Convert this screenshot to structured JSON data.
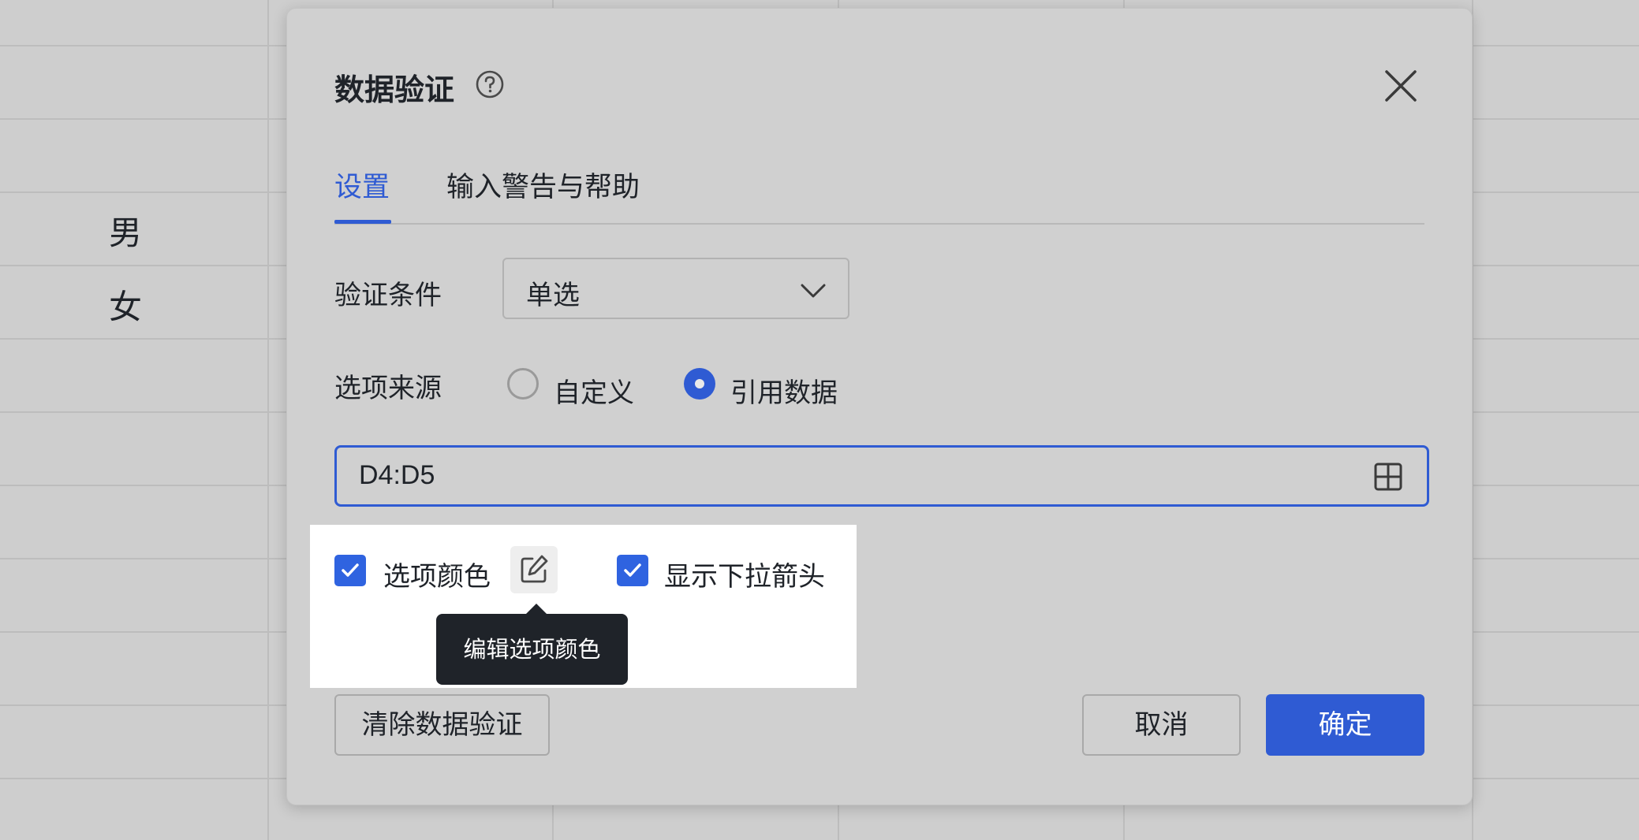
{
  "sheet": {
    "cells": [
      "男",
      "女"
    ]
  },
  "dialog": {
    "title": "数据验证",
    "tabs": [
      {
        "label": "设置",
        "active": true
      },
      {
        "label": "输入警告与帮助",
        "active": false
      }
    ],
    "condition": {
      "label": "验证条件",
      "value": "单选"
    },
    "source": {
      "label": "选项来源",
      "options": [
        {
          "label": "自定义",
          "selected": false
        },
        {
          "label": "引用数据",
          "selected": true
        }
      ]
    },
    "range": {
      "value": "D4:D5"
    },
    "options": {
      "color": {
        "label": "选项颜色",
        "checked": true
      },
      "arrow": {
        "label": "显示下拉箭头",
        "checked": true
      }
    },
    "tooltip": "编辑选项颜色",
    "buttons": {
      "clear": "清除数据验证",
      "cancel": "取消",
      "confirm": "确定"
    }
  },
  "colors": {
    "accent": "#2f5bd3",
    "background": "#d0d0d0",
    "tooltip": "#1f2329"
  }
}
